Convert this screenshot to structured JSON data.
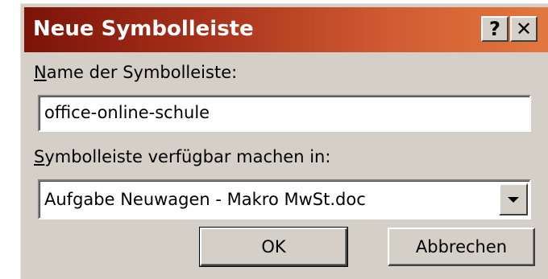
{
  "dialog": {
    "title": "Neue Symbolleiste",
    "help_glyph": "?",
    "close_glyph": "✕",
    "name_label_mnemonic": "N",
    "name_label_rest": "ame der Symbolleiste:",
    "name_value": "office-online-schule",
    "avail_label_mnemonic": "S",
    "avail_label_rest": "ymbolleiste verfügbar machen in:",
    "avail_selected": "Aufgabe Neuwagen - Makro MwSt.doc",
    "ok_label": "OK",
    "cancel_label": "Abbrechen"
  },
  "colors": {
    "titlebar_start": "#7c1308",
    "titlebar_end": "#e2773f",
    "face": "#d4d0c8"
  }
}
